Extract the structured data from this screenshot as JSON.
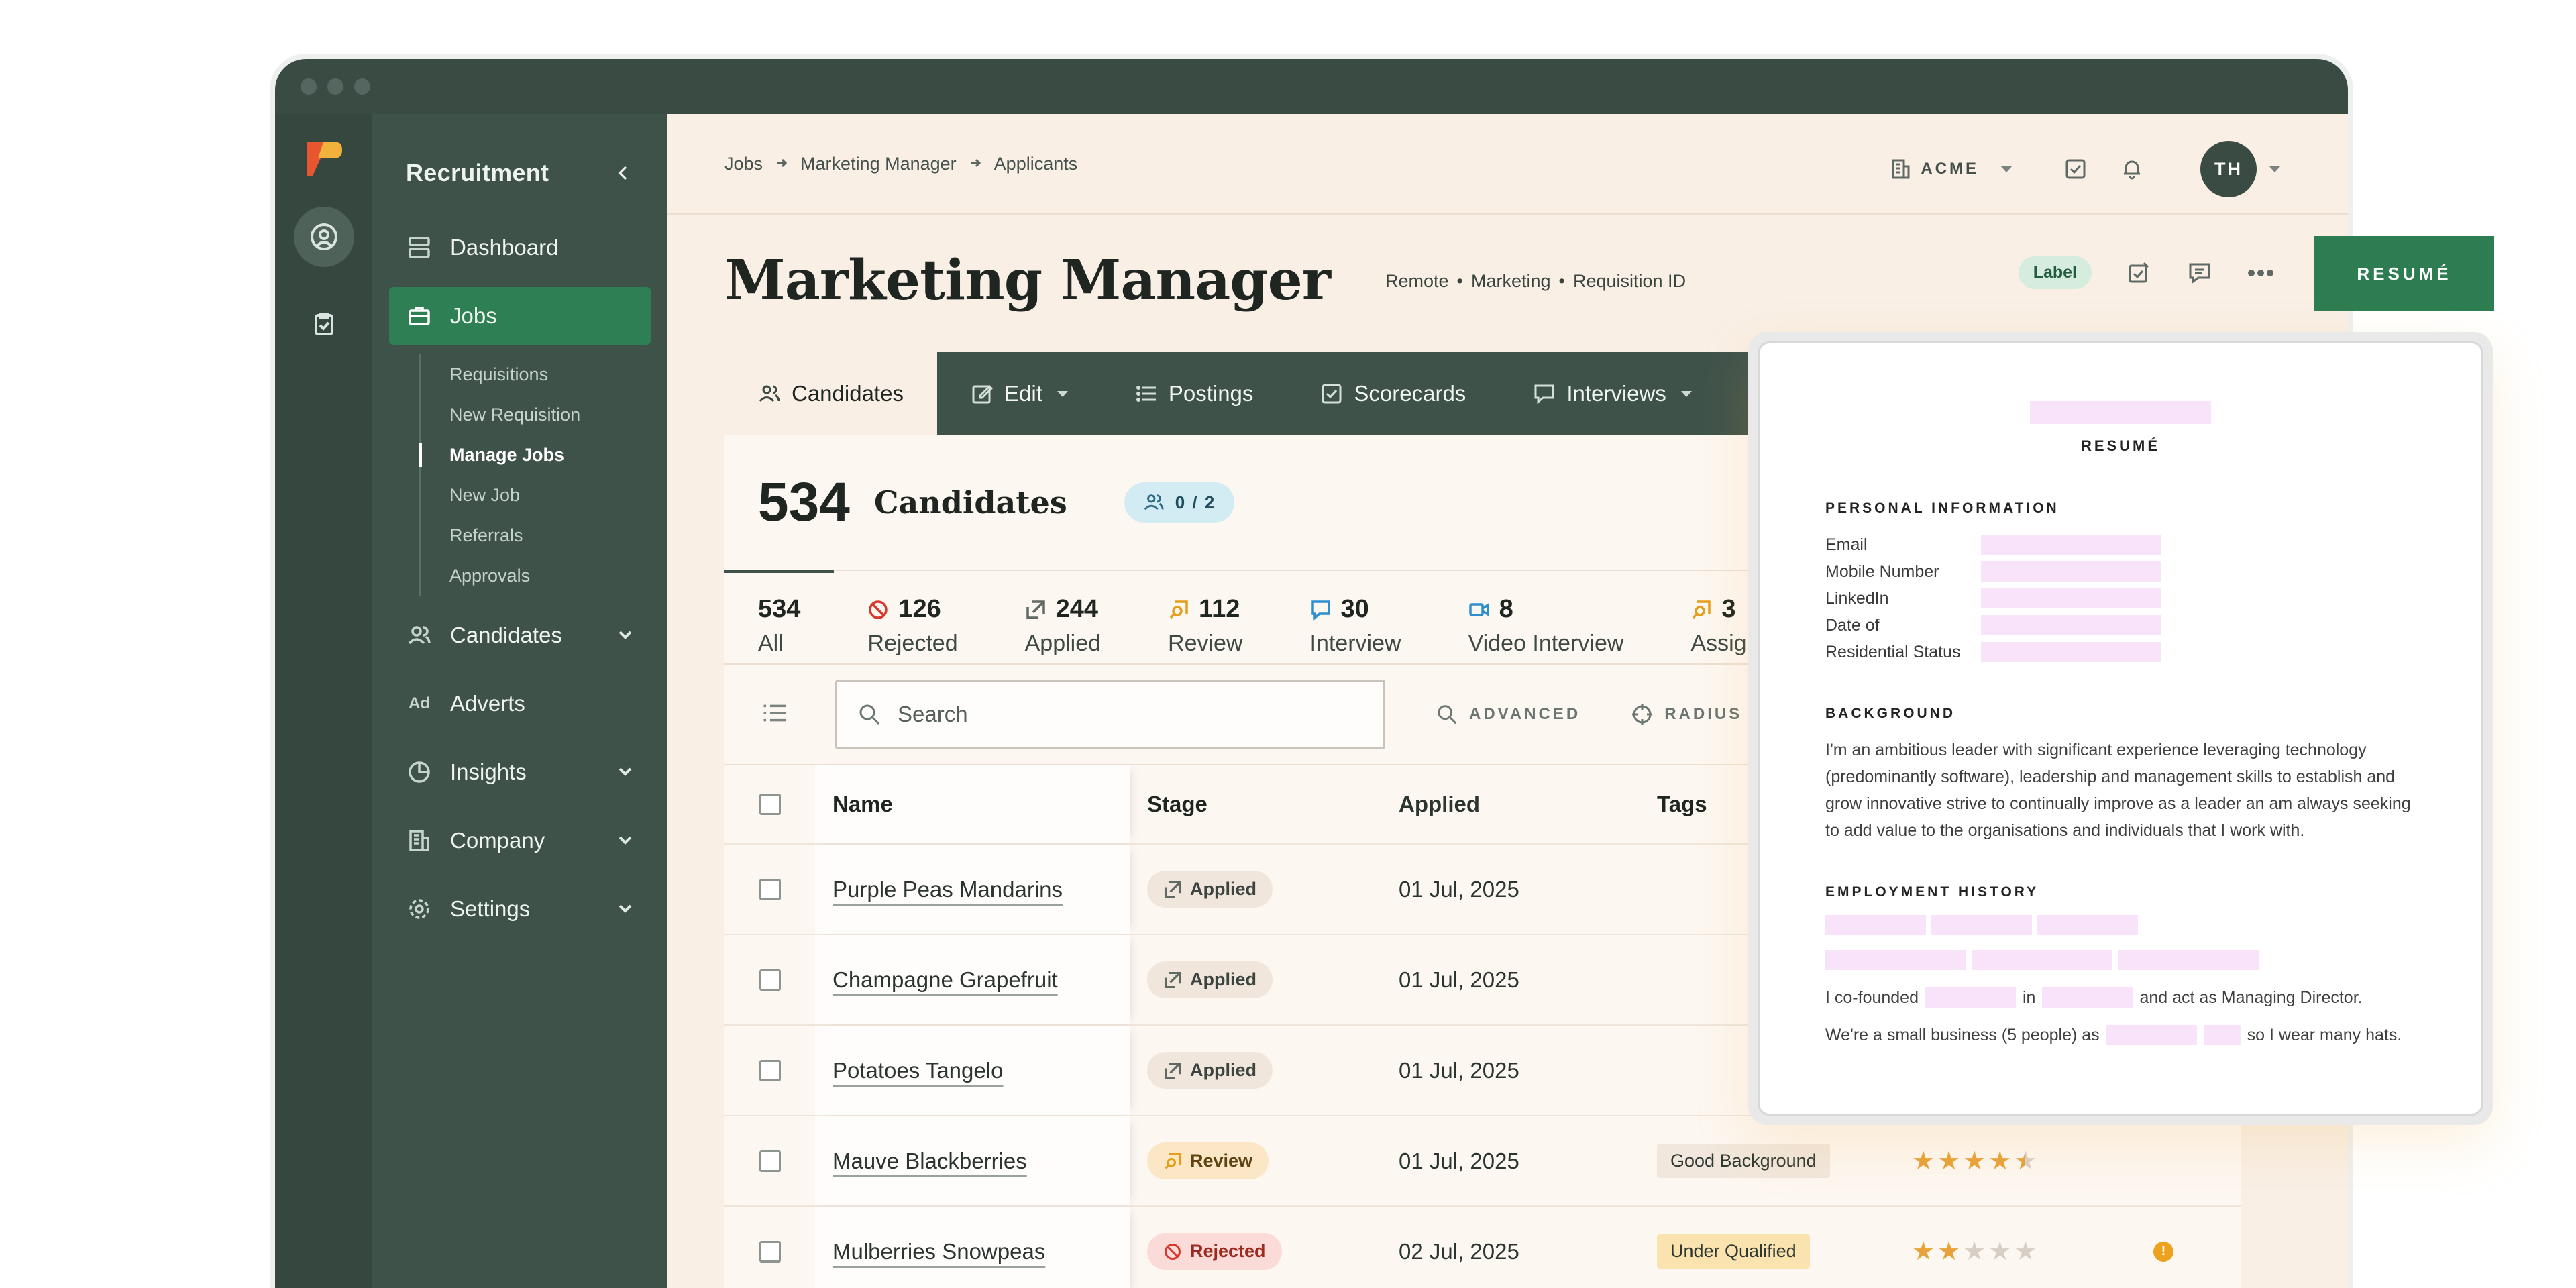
{
  "sidebar": {
    "title": "Recruitment",
    "items": [
      {
        "label": "Dashboard"
      },
      {
        "label": "Jobs"
      },
      {
        "label": "Candidates"
      },
      {
        "label": "Adverts",
        "icon_text": "Ad"
      },
      {
        "label": "Insights"
      },
      {
        "label": "Company"
      },
      {
        "label": "Settings"
      }
    ],
    "sub_items": [
      {
        "label": "Requisitions"
      },
      {
        "label": "New Requisition"
      },
      {
        "label": "Manage Jobs"
      },
      {
        "label": "New Job"
      },
      {
        "label": "Referrals"
      },
      {
        "label": "Approvals"
      }
    ]
  },
  "breadcrumb": [
    "Jobs",
    "Marketing Manager",
    "Applicants"
  ],
  "header": {
    "org": "ACME",
    "avatar_initials": "TH",
    "title": "Marketing Manager",
    "meta": [
      "Remote",
      "Marketing",
      "Requisition ID"
    ],
    "meta_sep": "•",
    "label_badge": "Label"
  },
  "tabs": [
    {
      "label": "Candidates"
    },
    {
      "label": "Edit"
    },
    {
      "label": "Postings"
    },
    {
      "label": "Scorecards"
    },
    {
      "label": "Interviews"
    }
  ],
  "summary": {
    "count": "534",
    "count_label": "Candidates",
    "team": "0 / 2"
  },
  "stages": [
    {
      "count": "534",
      "label": "All"
    },
    {
      "count": "126",
      "label": "Rejected"
    },
    {
      "count": "244",
      "label": "Applied"
    },
    {
      "count": "112",
      "label": "Review"
    },
    {
      "count": "30",
      "label": "Interview"
    },
    {
      "count": "8",
      "label": "Video Interview"
    },
    {
      "count": "3",
      "label": "Assignm"
    }
  ],
  "toolbar": {
    "search_placeholder": "Search",
    "advanced": "ADVANCED",
    "radius": "RADIUS"
  },
  "table": {
    "columns": [
      "Name",
      "Stage",
      "Applied",
      "Tags"
    ],
    "rows": [
      {
        "name": "Purple Peas Mandarins",
        "stage": "Applied",
        "applied": "01 Jul, 2025",
        "tag": "",
        "rating": null
      },
      {
        "name": "Champagne Grapefruit",
        "stage": "Applied",
        "applied": "01 Jul, 2025",
        "tag": "",
        "rating": null
      },
      {
        "name": "Potatoes Tangelo",
        "stage": "Applied",
        "applied": "01 Jul, 2025",
        "tag": "",
        "rating": null
      },
      {
        "name": "Mauve Blackberries",
        "stage": "Review",
        "applied": "01 Jul, 2025",
        "tag": "Good Background",
        "rating": 4.5
      },
      {
        "name": "Mulberries Snowpeas",
        "stage": "Rejected",
        "applied": "02 Jul, 2025",
        "tag": "Under Qualified",
        "rating": 2,
        "alert": "!"
      }
    ]
  },
  "resume_button": "RESUMÉ",
  "resume": {
    "heading": "RESUMÉ",
    "personal_heading": "PERSONAL INFORMATION",
    "personal_fields": [
      "Email",
      "Mobile Number",
      "LinkedIn",
      "Date of",
      "Residential Status"
    ],
    "background_heading": "BACKGROUND",
    "background_text": "I'm an ambitious leader with significant experience leveraging technology (predominantly software), leadership and management skills to establish and grow innovative strive to continually improve as a leader an am always seeking to add value to the organisations and individuals that I work with.",
    "employment_heading": "EMPLOYMENT HISTORY",
    "history_line1_a": "I co-founded",
    "history_line1_b": "in",
    "history_line1_c": "and act as Managing Director.",
    "history_line2_a": "We're a small business (5 people) as",
    "history_line2_b": "so I wear many hats."
  },
  "colors": {
    "sidebar": "#3f524a",
    "accent_green": "#2f7f55",
    "page_bg": "#f9efe5",
    "redacted": "#f9e3fb"
  }
}
